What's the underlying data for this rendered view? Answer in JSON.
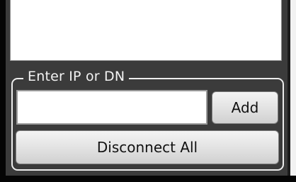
{
  "connection_panel": {
    "group_label": "Enter IP or DN",
    "ip_input": {
      "value": "",
      "placeholder": ""
    },
    "add_button_label": "Add",
    "disconnect_all_label": "Disconnect All"
  }
}
